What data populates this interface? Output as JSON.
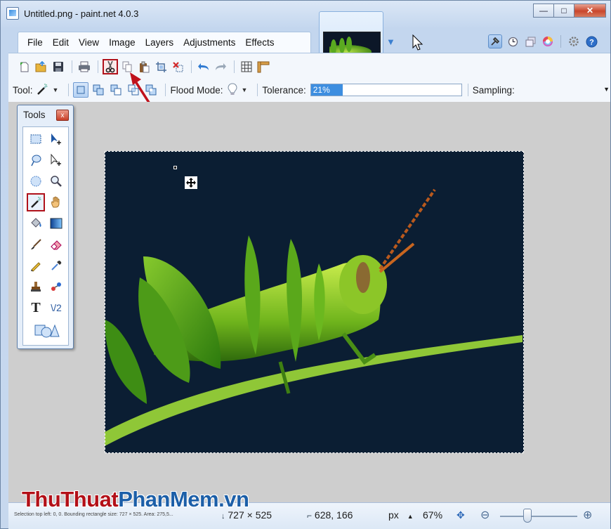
{
  "window": {
    "title": "Untitled.png - paint.net 4.0.3",
    "min_glyph": "—",
    "max_glyph": "□",
    "close_glyph": "✕"
  },
  "menu": {
    "items": [
      "File",
      "Edit",
      "View",
      "Image",
      "Layers",
      "Adjustments",
      "Effects"
    ]
  },
  "toolbar": {
    "tool_label": "Tool:",
    "flood_mode_label": "Flood Mode:",
    "tolerance_label": "Tolerance:",
    "tolerance_value": "21%",
    "tolerance_fraction": 0.21,
    "sampling_label": "Sampling:",
    "highlighted_button": "cut"
  },
  "tools_window": {
    "title": "Tools",
    "close_glyph": "x",
    "selected_tool": "magic-wand",
    "text_tool_glyph": "T",
    "line_tool_glyph": "\\/2"
  },
  "status": {
    "selection_info": "Selection top left: 0, 0. Bounding rectangle size: 727 × 525. Area: 275,5...",
    "image_size": "727 × 525",
    "cursor_pos": "628, 166",
    "unit": "px",
    "zoom": "67%"
  },
  "watermark": {
    "part1": "ThuThuat",
    "part2": "PhanMem",
    "part3": ".vn"
  },
  "colors": {
    "highlight_red": "#b0121b",
    "canvas_bg": "#0b1e33",
    "tolerance_fill": "#3d8ee0"
  }
}
